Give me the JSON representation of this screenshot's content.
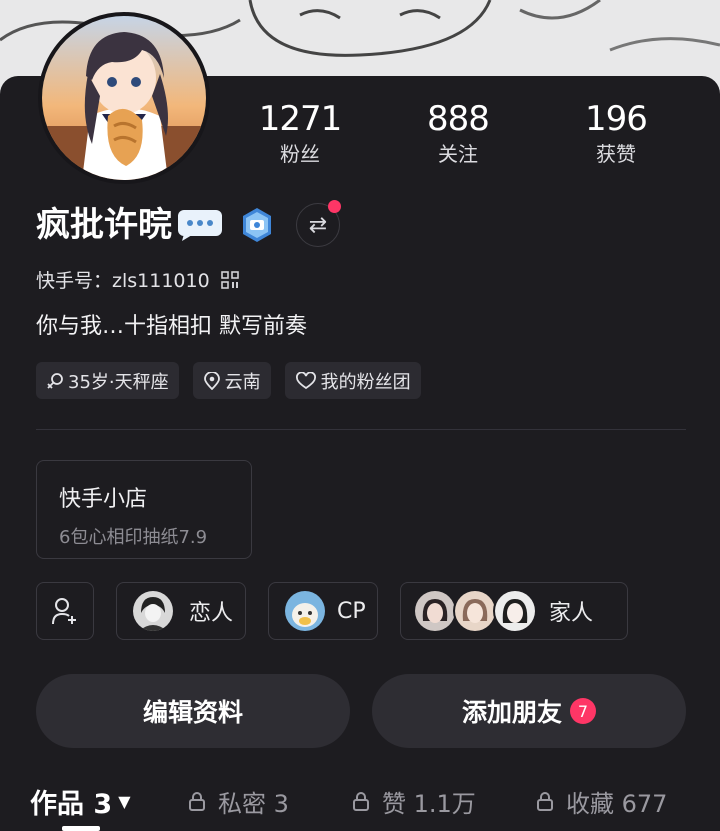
{
  "stats": {
    "fans": {
      "value": "1271",
      "label": "粉丝"
    },
    "following": {
      "value": "888",
      "label": "关注"
    },
    "likes": {
      "value": "196",
      "label": "获赞"
    }
  },
  "profile": {
    "name": "疯批许晥",
    "kuaishou_id": "快手号：zls111010",
    "bio": "你与我…十指相扣 默写前奏"
  },
  "tags": [
    {
      "label": "35岁·天秤座",
      "icon": "gender-icon"
    },
    {
      "label": "云南",
      "icon": "location-icon"
    },
    {
      "label": "我的粉丝团",
      "icon": "heart-icon"
    }
  ],
  "shop": {
    "title": "快手小店",
    "subtitle": "6包心相印抽纸7.9"
  },
  "relations": [
    {
      "label": "恋人"
    },
    {
      "label": "CP"
    },
    {
      "label": "家人"
    }
  ],
  "actions": {
    "edit_label": "编辑资料",
    "add_friend_label": "添加朋友",
    "add_friend_count": "7"
  },
  "tabs": [
    {
      "label": "作品 3",
      "active": true
    },
    {
      "label": "私密 3"
    },
    {
      "label": "赞 1.1万"
    },
    {
      "label": "收藏 677"
    }
  ],
  "colors": {
    "accent": "#fe3666",
    "card_bg": "#1d1c20",
    "chip_bg": "#2c2b31"
  }
}
